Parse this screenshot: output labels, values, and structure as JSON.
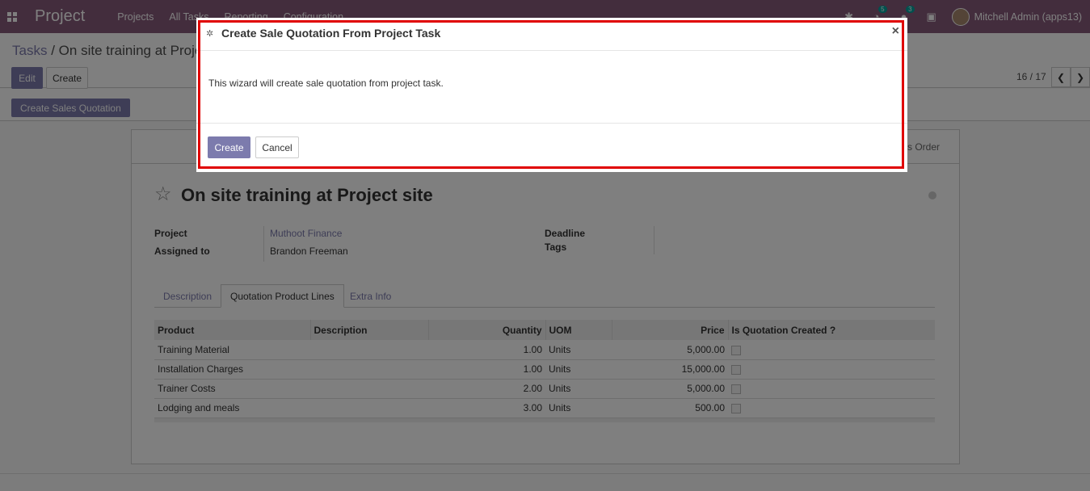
{
  "navbar": {
    "app_name": "Project",
    "menu": [
      "Projects",
      "All Tasks",
      "Reporting",
      "Configuration"
    ],
    "activity_badge": "5",
    "messages_badge": "3",
    "user_name": "Mitchell Admin (apps13)"
  },
  "control_panel": {
    "breadcrumb_parent": "Tasks",
    "breadcrumb_separator": "/",
    "breadcrumb_current": "On site training at Project site",
    "edit_label": "Edit",
    "create_label": "Create",
    "pager": "16 / 17"
  },
  "statusbar": {
    "create_sales_quotation_label": "Create Sales Quotation"
  },
  "form": {
    "smart_button_label": "Sales Order",
    "title": "On site training at Project site",
    "project_label": "Project",
    "project_value": "Muthoot Finance",
    "assigned_label": "Assigned to",
    "assigned_value": "Brandon Freeman",
    "deadline_label": "Deadline",
    "tags_label": "Tags",
    "tabs": [
      "Description",
      "Quotation Product Lines",
      "Extra Info"
    ],
    "columns": [
      "Product",
      "Description",
      "Quantity",
      "UOM",
      "Price",
      "Is Quotation Created ?"
    ],
    "rows": [
      {
        "product": "Training Material",
        "description": "",
        "quantity": "1.00",
        "uom": "Units",
        "price": "5,000.00"
      },
      {
        "product": "Installation Charges",
        "description": "",
        "quantity": "1.00",
        "uom": "Units",
        "price": "15,000.00"
      },
      {
        "product": "Trainer Costs",
        "description": "",
        "quantity": "2.00",
        "uom": "Units",
        "price": "5,000.00"
      },
      {
        "product": "Lodging and meals",
        "description": "",
        "quantity": "3.00",
        "uom": "Units",
        "price": "500.00"
      }
    ]
  },
  "modal": {
    "title": "Create Sale Quotation From Project Task",
    "close_symbol": "×",
    "body_text": "This wizard will create sale quotation from project task.",
    "create_label": "Create",
    "cancel_label": "Cancel"
  },
  "colors": {
    "brand": "#875a7b",
    "primary_button": "#7c7bad",
    "highlight_border": "#e00000"
  }
}
